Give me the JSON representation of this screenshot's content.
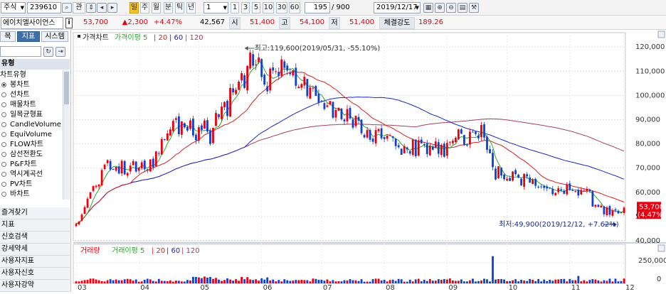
{
  "toolbar": {
    "market": "주식",
    "code": "239610",
    "btn_gwan": "관",
    "period_buttons": [
      "일",
      "주",
      "월",
      "분",
      "틱",
      "년"
    ],
    "interval_value": "1",
    "quick_intervals": [
      "1",
      "3",
      "5",
      "10",
      "30",
      "60"
    ],
    "count": "195",
    "total": "/ 900",
    "date": "2019/12/17"
  },
  "quote": {
    "name": "에이치엘사이언스",
    "info_icon": "i",
    "price": "53,700",
    "change": "▲2,300",
    "rate": "+4.47%",
    "volume": "42,567",
    "open_label": "시",
    "open": "51,400",
    "high_label": "고",
    "high": "54,100",
    "low_label": "저",
    "low": "51,400",
    "strength_label": "체결강도",
    "strength": "189.26"
  },
  "sidebar": {
    "tabs": [
      "목",
      "지표",
      "시스템"
    ],
    "section_title": "유형",
    "group_title": "차트유형",
    "chart_types": [
      "봉차트",
      "선차트",
      "매물차트",
      "일목균형표",
      "CandleVolume",
      "EquiVolume",
      "FLOW차트",
      "삼선전환도",
      "P&F차트",
      "역시계곡선",
      "PV차트",
      "바차트"
    ],
    "selected_index": 0,
    "menu": [
      "즐겨찾기",
      "지표",
      "신호검색",
      "강세약세",
      "사용자지표",
      "사용자신호",
      "사용자강약"
    ]
  },
  "chart": {
    "price_legend": {
      "title": "가격차트",
      "ma_label": "가격이평",
      "ma_periods": [
        "5",
        "20",
        "60",
        "120"
      ]
    },
    "volume_legend": {
      "title": "거래량",
      "ma_label": "거래이평",
      "ma_periods": [
        "5",
        "20",
        "60",
        "120"
      ]
    },
    "high_note": "최고:119,600(2019/05/31, -55.10%)",
    "low_note": "최저:49,900(2019/12/12, +7.62%)",
    "current_price_tag": "53,700",
    "current_rate_tag": "(4.47%)",
    "price_axis": [
      "120,000",
      "110,000",
      "100,000",
      "90,000",
      "80,000",
      "70,000",
      "60,000",
      "50,000",
      "40,000"
    ],
    "volume_axis": [
      "250,000",
      "0"
    ],
    "months": [
      "03",
      "04",
      "05",
      "06",
      "07",
      "08",
      "09",
      "10",
      "11",
      "12"
    ],
    "colors": {
      "up": "#e8000f",
      "down": "#1040d0",
      "ma5": "#31a531",
      "ma20": "#d22222",
      "ma60": "#1c27c4",
      "ma120": "#a5405a",
      "bg": "#ffffff",
      "grid": "#e3e3e3"
    }
  },
  "chart_data": {
    "type": "candlestick",
    "ylim": [
      40000,
      123000
    ],
    "price_path_daily_close": [
      47000,
      47900,
      50800,
      53900,
      57400,
      60000,
      62600,
      62700,
      63200,
      69200,
      71400,
      73300,
      69400,
      69500,
      70500,
      67800,
      73000,
      67400,
      68000,
      71000,
      72900,
      68600,
      70100,
      72400,
      69500,
      69000,
      73600,
      70300,
      76900,
      76100,
      82000,
      81800,
      84300,
      86000,
      89500,
      90600,
      84000,
      89300,
      86800,
      85500,
      89700,
      83500,
      81500,
      86900,
      85800,
      89700,
      85100,
      80000,
      86600,
      92800,
      91100,
      95400,
      97300,
      91500,
      103100,
      101300,
      102300,
      105700,
      109200,
      103100,
      112200,
      117700,
      112300,
      112800,
      115700,
      107600,
      104500,
      101700,
      111100,
      110300,
      110000,
      108000,
      114900,
      111400,
      110300,
      108800,
      110400,
      104000,
      103600,
      104700,
      107700,
      99700,
      103300,
      103200,
      99800,
      97100,
      97700,
      94400,
      95900,
      97700,
      90800,
      94000,
      94900,
      90200,
      89300,
      94400,
      90500,
      86700,
      91600,
      89600,
      84400,
      82700,
      85700,
      81700,
      80900,
      85700,
      86100,
      82300,
      82000,
      83400,
      83600,
      82500,
      79100,
      78600,
      75500,
      79000,
      77700,
      76000,
      81800,
      74900,
      81500,
      80200,
      79700,
      75800,
      79200,
      77600,
      81000,
      75900,
      79600,
      74700,
      80400,
      80900,
      81300,
      82500,
      86000,
      84200,
      79500,
      79600,
      85000,
      85000,
      84100,
      82300,
      87800,
      82600,
      77500,
      76100,
      70400,
      65300,
      70700,
      66900,
      65400,
      65500,
      64700,
      68600,
      67500,
      66000,
      62900,
      67600,
      66600,
      64000,
      65300,
      62700,
      62100,
      62300,
      61800,
      61600,
      61700,
      59200,
      59800,
      61700,
      60800,
      59400,
      63300,
      61000,
      60800,
      60500,
      58700,
      61000,
      60700,
      61300,
      60500,
      54100,
      54800,
      54000,
      54500,
      50900,
      53800,
      50700,
      52600,
      52500,
      51300,
      51600,
      53700
    ],
    "ma_lines": [
      "5",
      "20",
      "60",
      "120"
    ],
    "volume_scale_max": 250000
  }
}
